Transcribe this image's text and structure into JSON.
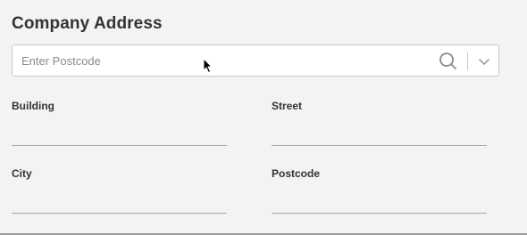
{
  "section": {
    "title": "Company Address"
  },
  "postcode_lookup": {
    "placeholder": "Enter Postcode",
    "value": ""
  },
  "fields": {
    "building": {
      "label": "Building",
      "value": ""
    },
    "street": {
      "label": "Street",
      "value": ""
    },
    "city": {
      "label": "City",
      "value": ""
    },
    "postcode": {
      "label": "Postcode",
      "value": ""
    }
  },
  "icons": {
    "search": "search-icon",
    "dropdown": "chevron-down-icon",
    "cursor": "mouse-pointer-icon"
  },
  "colors": {
    "background": "#f3f3f3",
    "input_border": "#c9c9c9",
    "underline": "#a9a9a9",
    "text": "#333333",
    "placeholder": "#8a8a8a",
    "icon": "#8a8a8a"
  }
}
